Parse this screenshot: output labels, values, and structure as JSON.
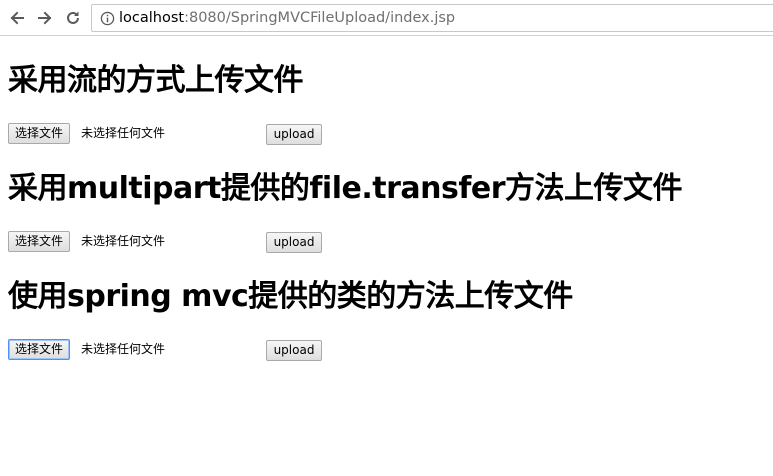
{
  "browser": {
    "back_icon": "back-arrow-icon",
    "forward_icon": "forward-arrow-icon",
    "reload_icon": "reload-icon",
    "info_icon": "info-icon",
    "url_host": "localhost",
    "url_rest": ":8080/SpringMVCFileUpload/index.jsp"
  },
  "sections": [
    {
      "title": "采用流的方式上传文件",
      "file_button_label": "选择文件",
      "file_status": "未选择任何文件",
      "upload_label": "upload"
    },
    {
      "title": "采用multipart提供的file.transfer方法上传文件",
      "file_button_label": "选择文件",
      "file_status": "未选择任何文件",
      "upload_label": "upload"
    },
    {
      "title": "使用spring mvc提供的类的方法上传文件",
      "file_button_label": "选择文件",
      "file_status": "未选择任何文件",
      "upload_label": "upload"
    }
  ],
  "colors": {
    "focus_border": "#4d90fe",
    "url_rest": "#707070"
  }
}
